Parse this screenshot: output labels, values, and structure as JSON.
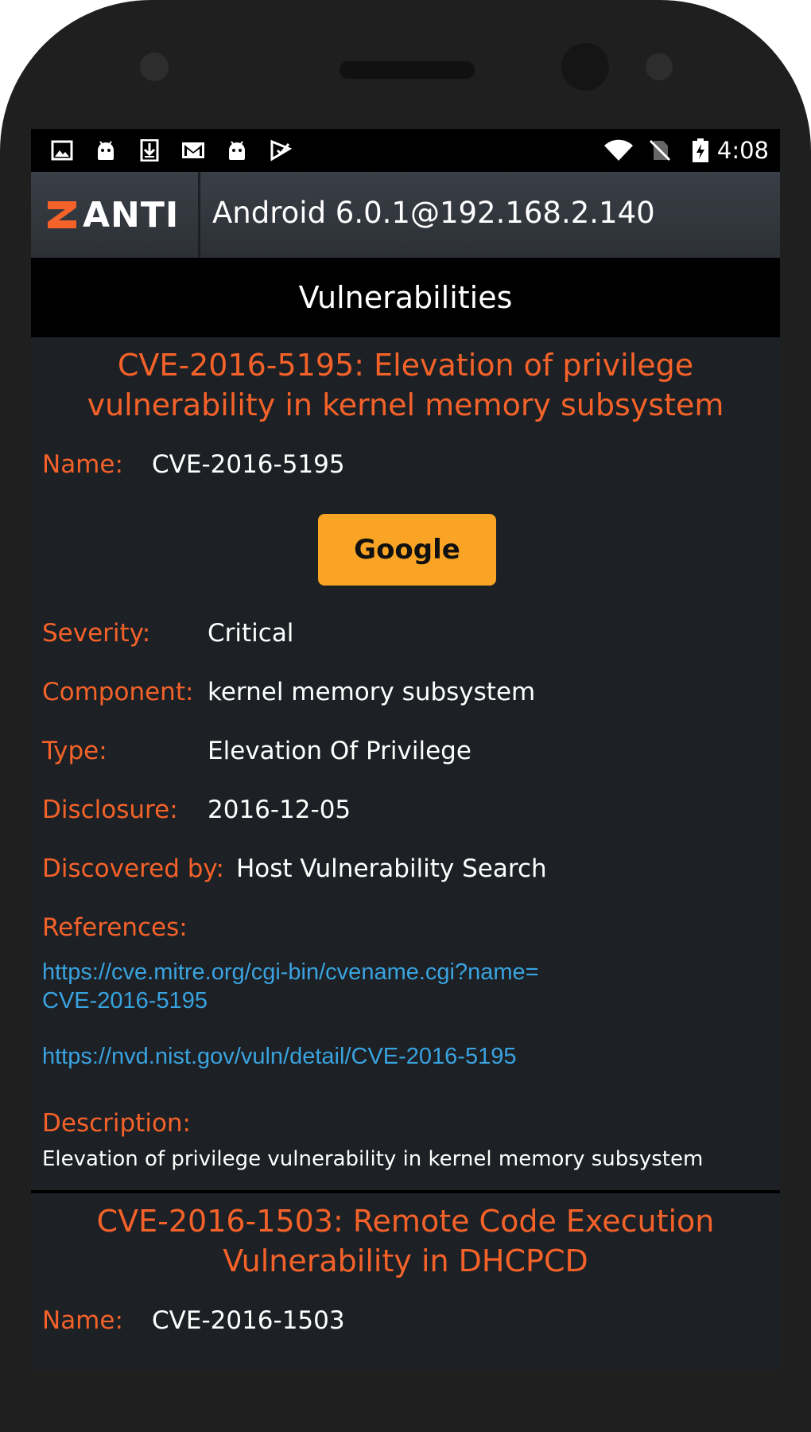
{
  "status_bar": {
    "time": "4:08",
    "left_icons": [
      "image-icon",
      "android-icon",
      "download-icon",
      "gmail-icon",
      "android-icon",
      "tasker-icon"
    ],
    "right_icons": [
      "wifi-icon",
      "no-sim-icon",
      "battery-charging-icon"
    ]
  },
  "app_header": {
    "logo_text": "ANTI",
    "device_title": "Android 6.0.1@192.168.2.140"
  },
  "section": {
    "title": "Vulnerabilities"
  },
  "vulnerabilities": [
    {
      "title": "CVE-2016-5195: Elevation of privilege vulnerability in kernel memory subsystem",
      "name_label": "Name:",
      "name": "CVE-2016-5195",
      "google_button": "Google",
      "severity_label": "Severity:",
      "severity": "Critical",
      "component_label": "Component:",
      "component": "kernel memory subsystem",
      "type_label": "Type:",
      "type": "Elevation Of Privilege",
      "disclosure_label": "Disclosure:",
      "disclosure": "2016-12-05",
      "discovered_label": "Discovered by:",
      "discovered_by": "Host Vulnerability Search",
      "references_label": "References:",
      "references": [
        "https://cve.mitre.org/cgi-bin/cvename.cgi?name=CVE-2016-5195",
        "https://nvd.nist.gov/vuln/detail/CVE-2016-5195"
      ],
      "description_label": "Description:",
      "description": "Elevation of privilege vulnerability in kernel memory subsystem"
    },
    {
      "title": "CVE-2016-1503: Remote Code Execution Vulnerability in DHCPCD",
      "name_label": "Name:",
      "name": "CVE-2016-1503"
    }
  ],
  "colors": {
    "accent": "#f4622a",
    "button": "#f9a424",
    "link": "#39a3e0",
    "background": "#1d2024"
  }
}
